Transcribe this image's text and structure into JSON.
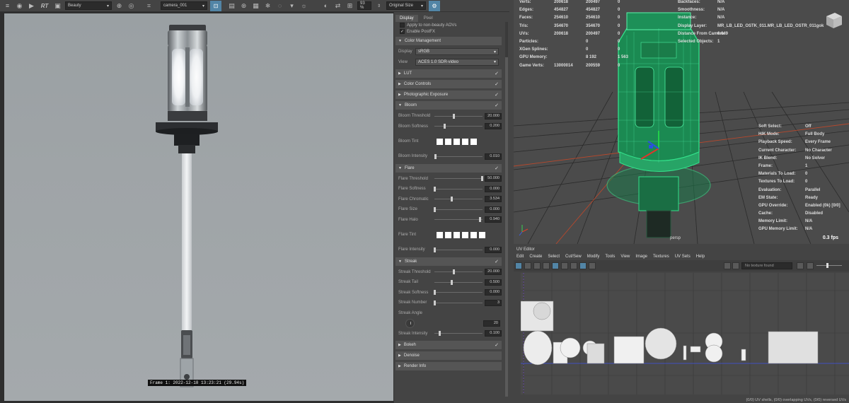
{
  "toolbar": {
    "rt_label": "RT",
    "layer": "Beauty",
    "camera": "camera_001",
    "zoom": "93 %",
    "size_mode": "Original Size"
  },
  "render": {
    "frame_caption": "Frame 1: 2022-12-18 13:23:21 (29.94s)"
  },
  "settings": {
    "tabs": [
      "Display",
      "Pixel"
    ],
    "top_options": [
      {
        "label": "Apply to non-beauty AOVs",
        "checked": false
      },
      {
        "label": "Enable PostFX",
        "checked": true
      }
    ],
    "color_management": {
      "title": "Color Management",
      "display_label": "Display",
      "display_value": "sRGB",
      "view_label": "View",
      "view_value": "ACES 1.0 SDR-video"
    },
    "collapsed_top": [
      "LUT",
      "Color Controls",
      "Photographic Exposure"
    ],
    "bloom": {
      "title": "Bloom",
      "params": [
        {
          "label": "Bloom Threshold",
          "value": "20.000",
          "pos": 0.4
        },
        {
          "label": "Bloom Softness",
          "value": "0.200",
          "pos": 0.2
        }
      ],
      "tint_label": "Bloom Tint",
      "swatch_count": 5,
      "intensity": {
        "label": "Bloom Intensity",
        "value": "0.010",
        "pos": 0.02
      }
    },
    "flare": {
      "title": "Flare",
      "params": [
        {
          "label": "Flare Threshold",
          "value": "50.000",
          "pos": 0.98
        },
        {
          "label": "Flare Softness",
          "value": "0.000",
          "pos": 0.0
        },
        {
          "label": "Flare Chromatic",
          "value": "3.534",
          "pos": 0.35
        },
        {
          "label": "Flare Size",
          "value": "0.000",
          "pos": 0.0
        },
        {
          "label": "Flare Halo",
          "value": "0.940",
          "pos": 0.94
        }
      ],
      "tint_label": "Flare Tint",
      "swatch_count": 6,
      "intensity": {
        "label": "Flare Intensity",
        "value": "0.000",
        "pos": 0.0
      }
    },
    "streak": {
      "title": "Streak",
      "params": [
        {
          "label": "Streak Threshold",
          "value": "20.000",
          "pos": 0.4
        },
        {
          "label": "Streak Tail",
          "value": "0.500",
          "pos": 0.35
        },
        {
          "label": "Streak Softness",
          "value": "0.000",
          "pos": 0.0
        },
        {
          "label": "Streak Number",
          "value": "3",
          "pos": 0.0
        }
      ],
      "angle_label": "Streak Angle",
      "angle_value": "20",
      "intensity": {
        "label": "Streak Intensity",
        "value": "0.100",
        "pos": 0.1
      }
    },
    "collapsed_bottom": [
      {
        "label": "Bokeh",
        "checked": true
      },
      {
        "label": "Denoise",
        "checked": false
      },
      {
        "label": "Render Info",
        "checked": false
      }
    ]
  },
  "viewport": {
    "hud_left": [
      {
        "k": "Verts:",
        "a": "200618",
        "b": "200497",
        "c": "0"
      },
      {
        "k": "Edges:",
        "a": "454827",
        "b": "454827",
        "c": "0"
      },
      {
        "k": "Faces:",
        "a": "254610",
        "b": "254610",
        "c": "0"
      },
      {
        "k": "Tris:",
        "a": "354670",
        "b": "354670",
        "c": "0"
      },
      {
        "k": "UVs:",
        "a": "200618",
        "b": "200497",
        "c": "0"
      },
      {
        "k": "Particles:",
        "a": "",
        "b": "0",
        "c": "0"
      },
      {
        "k": "XGen Splines:",
        "a": "",
        "b": "0",
        "c": "0"
      },
      {
        "k": "GPU Memory:",
        "a": "",
        "b": "8 192",
        "c": "1 563"
      },
      {
        "k": "Game Verts:",
        "a": "13000014",
        "b": "200559",
        "c": "0"
      }
    ],
    "hud_mid": [
      {
        "k": "Backfaces:",
        "v": "N/A"
      },
      {
        "k": "Smoothness:",
        "v": "N/A"
      },
      {
        "k": "Instance:",
        "v": "N/A"
      },
      {
        "k": "Display Layer:",
        "v": "MR_LB_LED_OSTK_011.MR_LB_LED_OSTR_011gok"
      },
      {
        "k": "Distance From Camera:",
        "v": "6.649"
      },
      {
        "k": "Selected Objects:",
        "v": "1"
      }
    ],
    "hud_right": [
      {
        "k": "Soft Select:",
        "v": "Off"
      },
      {
        "k": "HIK Mode:",
        "v": "Full Body"
      },
      {
        "k": "Playback Speed:",
        "v": "Every Frame"
      },
      {
        "k": "Current Character:",
        "v": "No Character"
      },
      {
        "k": "IK Blend:",
        "v": "No Solver"
      },
      {
        "k": "Frame:",
        "v": "1"
      },
      {
        "k": "Materials To Load:",
        "v": "0"
      },
      {
        "k": "Textures To Load:",
        "v": "0"
      },
      {
        "k": "Evaluation:",
        "v": "Parallel"
      },
      {
        "k": "EM State:",
        "v": "Ready"
      },
      {
        "k": "GPU Override:",
        "v": "Enabled (0k) [0/0]"
      },
      {
        "k": "Cache:",
        "v": "Disabled"
      },
      {
        "k": "Memory Limit:",
        "v": "N/A"
      },
      {
        "k": "GPU Memory Limit:",
        "v": "N/A"
      }
    ],
    "camera_label": "persp",
    "fps": "0.3 fps"
  },
  "uv_editor": {
    "title": "UV Editor",
    "menu": [
      "Edit",
      "Create",
      "Select",
      "Cut/Sew",
      "Modify",
      "Tools",
      "View",
      "Image",
      "Textures",
      "UV Sets",
      "Help"
    ],
    "texture_placeholder": "No texture found",
    "status": "(0/0) UV shells, (0/0) overlapping UVs, (0/0) reversed UVs"
  },
  "colors": {
    "accent": "#5285a6",
    "wireframe": "#33e08a",
    "grid_red": "#b8482c"
  }
}
